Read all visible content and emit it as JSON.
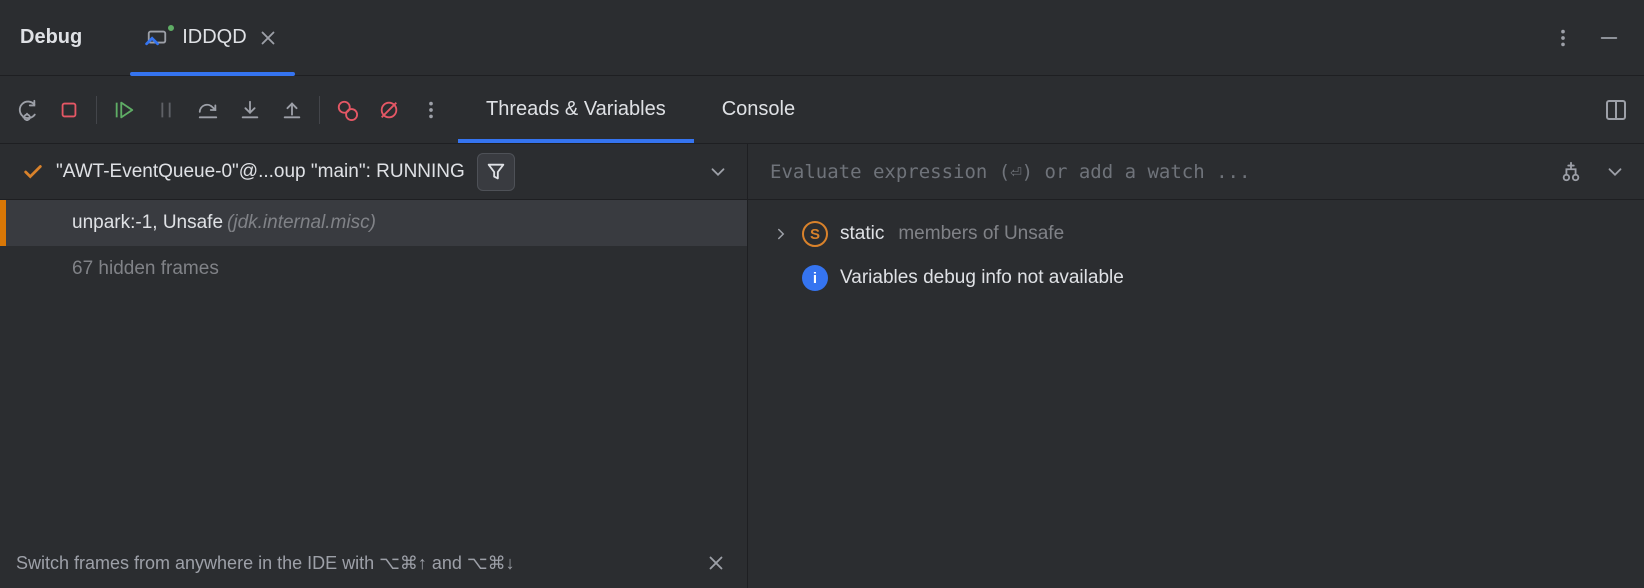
{
  "header": {
    "title": "Debug",
    "run_config_name": "IDDQD"
  },
  "toolbar": {
    "tabs": [
      "Threads & Variables",
      "Console"
    ],
    "active_tab": 0
  },
  "frames": {
    "thread_label": "\"AWT-EventQueue-0\"@...oup \"main\": RUNNING",
    "selected_frame": {
      "label": "unpark:-1, Unsafe",
      "package": "(jdk.internal.misc)"
    },
    "hidden_frames_label": "67 hidden frames",
    "hint": "Switch frames from anywhere in the IDE with ⌥⌘↑ and ⌥⌘↓"
  },
  "variables": {
    "eval_placeholder": "Evaluate expression (⏎) or add a watch ...",
    "static_row_prefix": "static",
    "static_row_suffix": "members of Unsafe",
    "info_row": "Variables debug info not available"
  }
}
